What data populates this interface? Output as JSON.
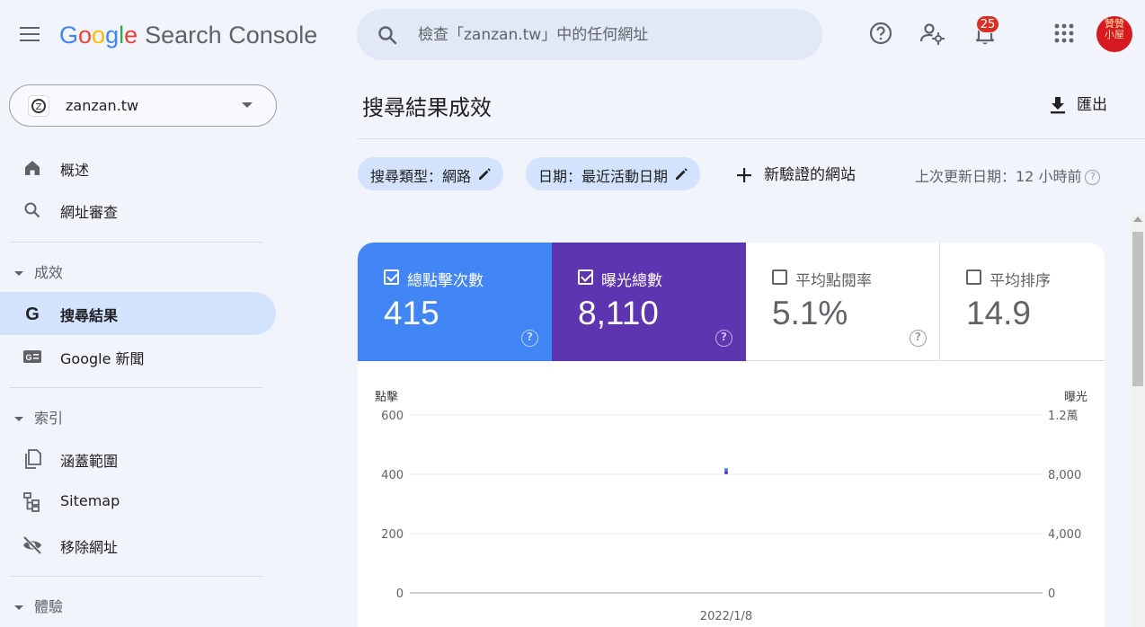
{
  "header": {
    "logo_letters": [
      "G",
      "o",
      "o",
      "g",
      "l",
      "e"
    ],
    "product_name": "Search Console",
    "search_placeholder": "檢查「zanzan.tw」中的任何網址",
    "notification_count": "25",
    "avatar_text": "贊贊小屋"
  },
  "sidebar": {
    "property": "zanzan.tw",
    "top_items": [
      {
        "label": "概述",
        "icon": "home-icon"
      },
      {
        "label": "網址審查",
        "icon": "search-icon"
      }
    ],
    "sections": [
      {
        "title": "成效",
        "items": [
          {
            "label": "搜尋結果",
            "icon": "google-g-icon",
            "active": true
          },
          {
            "label": "Google 新聞",
            "icon": "google-news-icon"
          }
        ]
      },
      {
        "title": "索引",
        "items": [
          {
            "label": "涵蓋範圍",
            "icon": "copy-pages-icon"
          },
          {
            "label": "Sitemap",
            "icon": "sitemap-icon"
          },
          {
            "label": "移除網址",
            "icon": "visibility-off-icon"
          }
        ]
      },
      {
        "title": "體驗",
        "items": []
      }
    ]
  },
  "main": {
    "title": "搜尋結果成效",
    "export_label": "匯出",
    "chips": [
      {
        "label": "搜尋類型：網路"
      },
      {
        "label": "日期：最近活動日期"
      }
    ],
    "add_site_label": "新驗證的網站",
    "updated_label": "上次更新日期：12 小時前"
  },
  "metrics": [
    {
      "label": "總點擊次數",
      "value": "415",
      "checked": true,
      "color": "#4285f4"
    },
    {
      "label": "曝光總數",
      "value": "8,110",
      "checked": true,
      "color": "#5e35b1"
    },
    {
      "label": "平均點閱率",
      "value": "5.1%",
      "checked": false
    },
    {
      "label": "平均排序",
      "value": "14.9",
      "checked": false
    }
  ],
  "chart_data": {
    "type": "line",
    "x": [
      "2022/1/8"
    ],
    "y_left_label": "點擊",
    "y_right_label": "曝光",
    "y_left_ticks": [
      "600",
      "400",
      "200",
      "0"
    ],
    "y_right_ticks": [
      "1.2萬",
      "8,000",
      "4,000",
      "0"
    ],
    "y_left_lim": [
      0,
      600
    ],
    "y_right_lim": [
      0,
      12000
    ],
    "series": [
      {
        "name": "點擊",
        "axis": "left",
        "values": [
          415
        ],
        "color": "#4285f4"
      },
      {
        "name": "曝光",
        "axis": "right",
        "values": [
          8110
        ],
        "color": "#5e35b1"
      }
    ]
  }
}
